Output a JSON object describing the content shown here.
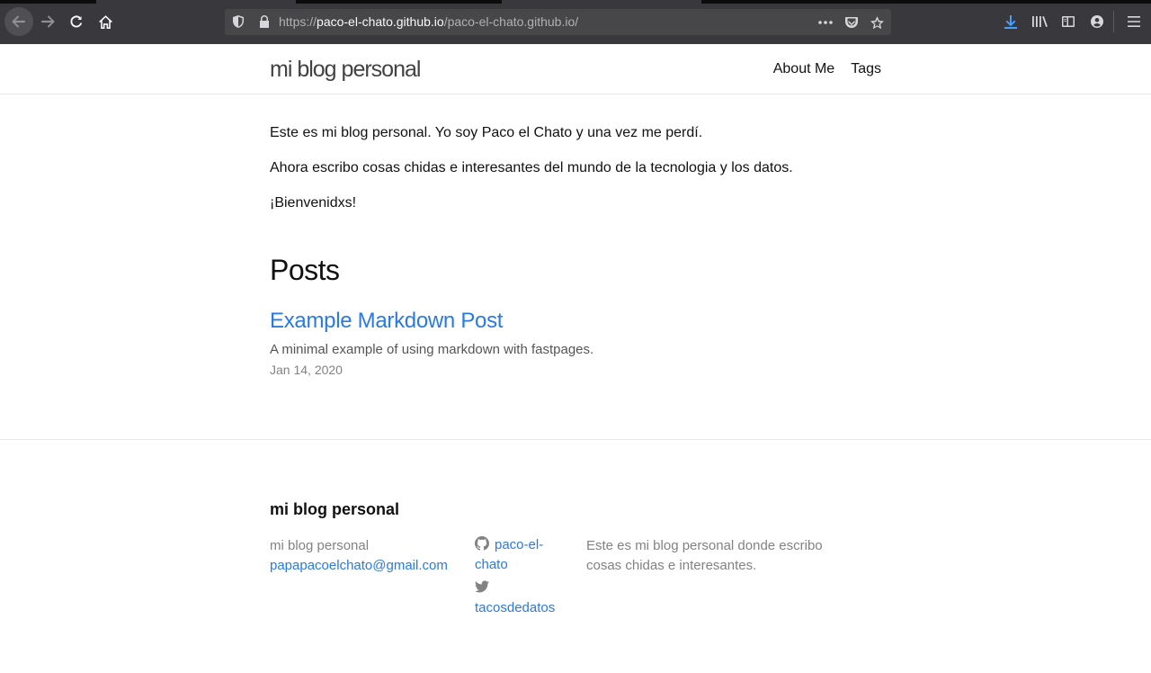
{
  "browser": {
    "url_scheme": "https://",
    "url_host": "paco-el-chato.github.io",
    "url_path": "/paco-el-chato.github.io/"
  },
  "site": {
    "title": "mi blog personal",
    "nav": [
      {
        "label": "About Me"
      },
      {
        "label": "Tags"
      }
    ]
  },
  "intro": {
    "p1": "Este es mi blog personal. Yo soy Paco el Chato y una vez me perdí.",
    "p2": "Ahora escribo cosas chidas e interesantes del mundo de la tecnologia y los datos.",
    "p3": "¡Bienvenidxs!"
  },
  "posts": {
    "heading": "Posts",
    "items": [
      {
        "title": "Example Markdown Post",
        "description": "A minimal example of using markdown with fastpages.",
        "date": "Jan 14, 2020"
      }
    ]
  },
  "footer": {
    "heading": "mi blog personal",
    "name": "mi blog personal",
    "email": "papapacoelchato@gmail.com",
    "github": "paco-el-chato",
    "twitter": "tacosdedatos",
    "description": "Este es mi blog personal donde escribo cosas chidas e interesantes."
  },
  "colors": {
    "link": "#2a7ae2",
    "chrome": "#38383d",
    "download_accent": "#45a1ff"
  }
}
